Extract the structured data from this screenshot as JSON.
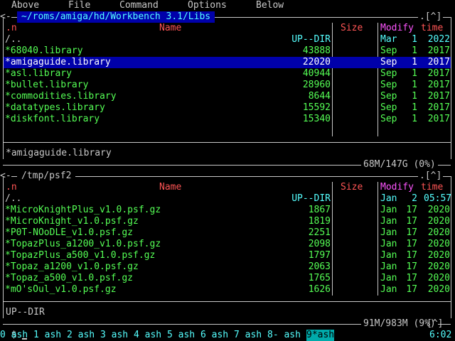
{
  "menu": [
    "Above",
    "File",
    "Command",
    "Options",
    "Below"
  ],
  "panels": [
    {
      "path": "~/roms/amiga/hd/Workbench 3.1/Libs",
      "top_right": "[^]",
      "headers": {
        "n": ".n",
        "name": "Name",
        "size": "Size",
        "modify": "Modify",
        "time": "time"
      },
      "rows": [
        {
          "name": "/..",
          "size": "UP--DIR",
          "mon": "Mar",
          "day": "1",
          "time": "2022",
          "type": "dir"
        },
        {
          "name": "*68040.library",
          "size": "43888",
          "mon": "Sep",
          "day": "1",
          "time": "2017",
          "type": "exec"
        },
        {
          "name": "*amigaguide.library",
          "size": "22020",
          "mon": "Sep",
          "day": "1",
          "time": "2017",
          "type": "selected"
        },
        {
          "name": "*asl.library",
          "size": "40944",
          "mon": "Sep",
          "day": "1",
          "time": "2017",
          "type": "exec"
        },
        {
          "name": "*bullet.library",
          "size": "28960",
          "mon": "Sep",
          "day": "1",
          "time": "2017",
          "type": "exec"
        },
        {
          "name": "*commodities.library",
          "size": "8644",
          "mon": "Sep",
          "day": "1",
          "time": "2017",
          "type": "exec"
        },
        {
          "name": "*datatypes.library",
          "size": "15592",
          "mon": "Sep",
          "day": "1",
          "time": "2017",
          "type": "exec"
        },
        {
          "name": "*diskfont.library",
          "size": "15340",
          "mon": "Sep",
          "day": "1",
          "time": "2017",
          "type": "exec"
        }
      ],
      "status": "*amigaguide.library",
      "disk": "68M/147G (0%)"
    },
    {
      "path": "/tmp/psf2",
      "top_right": "[^]",
      "headers": {
        "n": ".n",
        "name": "Name",
        "size": "Size",
        "modify": "Modify",
        "time": "time"
      },
      "rows": [
        {
          "name": "/..",
          "size": "UP--DIR",
          "mon": "Jan",
          "day": "2",
          "time": "05:57",
          "type": "dir"
        },
        {
          "name": "*MicroKnightPlus_v1.0.psf.gz",
          "size": "1867",
          "mon": "Jan",
          "day": "17",
          "time": "2020",
          "type": "exec"
        },
        {
          "name": "*MicroKnight_v1.0.psf.gz",
          "size": "1819",
          "mon": "Jan",
          "day": "17",
          "time": "2020",
          "type": "exec"
        },
        {
          "name": "*P0T-NOoDLE_v1.0.psf.gz",
          "size": "2251",
          "mon": "Jan",
          "day": "17",
          "time": "2020",
          "type": "exec"
        },
        {
          "name": "*TopazPlus_a1200_v1.0.psf.gz",
          "size": "2098",
          "mon": "Jan",
          "day": "17",
          "time": "2020",
          "type": "exec"
        },
        {
          "name": "*TopazPlus_a500_v1.0.psf.gz",
          "size": "1797",
          "mon": "Jan",
          "day": "17",
          "time": "2020",
          "type": "exec"
        },
        {
          "name": "*Topaz_a1200_v1.0.psf.gz",
          "size": "2063",
          "mon": "Jan",
          "day": "17",
          "time": "2020",
          "type": "exec"
        },
        {
          "name": "*Topaz_a500_v1.0.psf.gz",
          "size": "1765",
          "mon": "Jan",
          "day": "17",
          "time": "2020",
          "type": "exec"
        },
        {
          "name": "*mO'sOul_v1.0.psf.gz",
          "size": "1626",
          "mon": "Jan",
          "day": "17",
          "time": "2020",
          "type": "exec"
        }
      ],
      "status": "UP--DIR",
      "disk": "91M/983M (9%)"
    }
  ],
  "shell": {
    "prompt": "$",
    "top_right": "[^]"
  },
  "taskbar": [
    {
      "label": "0 ash",
      "active": false
    },
    {
      "label": "1 ash",
      "active": false
    },
    {
      "label": "2 ash",
      "active": false
    },
    {
      "label": "3 ash",
      "active": false
    },
    {
      "label": "4 ash",
      "active": false
    },
    {
      "label": "5 ash",
      "active": false
    },
    {
      "label": "6 ash",
      "active": false
    },
    {
      "label": "7 ash",
      "active": false
    },
    {
      "label": "8- ash",
      "active": false
    },
    {
      "label": "9*ash",
      "active": true
    }
  ],
  "clock": "6:02",
  "colors": {
    "exec": "#55ff55",
    "dir": "#55ffff",
    "header": "#ff5555",
    "modify": "#ff55ff",
    "selection": "#0000aa"
  }
}
